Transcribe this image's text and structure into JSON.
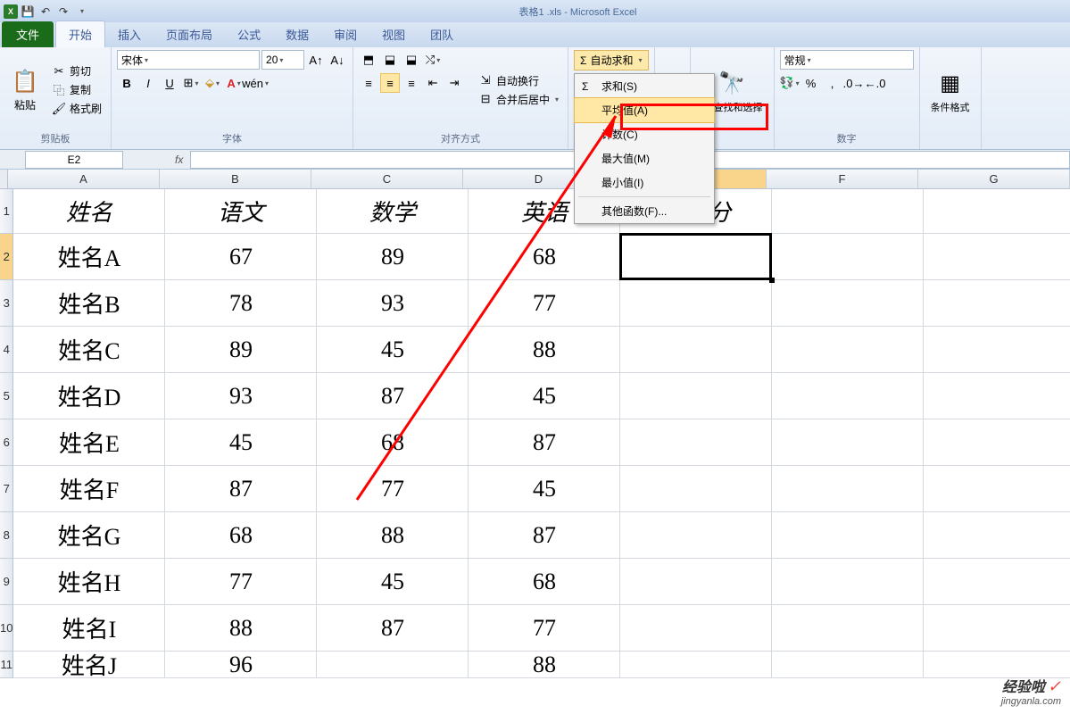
{
  "titlebar": {
    "title": "表格1 .xls - Microsoft Excel"
  },
  "tabs": {
    "file": "文件",
    "items": [
      "开始",
      "插入",
      "页面布局",
      "公式",
      "数据",
      "审阅",
      "视图",
      "团队"
    ]
  },
  "clipboard": {
    "paste": "粘贴",
    "cut": "剪切",
    "copy": "复制",
    "format_painter": "格式刷",
    "label": "剪贴板"
  },
  "font": {
    "name": "宋体",
    "size": "20",
    "label": "字体"
  },
  "align": {
    "wrap": "自动换行",
    "merge": "合并后居中",
    "label": "对齐方式"
  },
  "editing": {
    "autosum": "自动求和",
    "menu": {
      "sum": "求和(S)",
      "avg": "平均值(A)",
      "count": "计数(C)",
      "max": "最大值(M)",
      "min": "最小值(I)",
      "other": "其他函数(F)..."
    },
    "filter_select": "选 查找和选择"
  },
  "number": {
    "format": "常规",
    "label": "数字",
    "cond_format": "条件格式"
  },
  "find_icon": "查找",
  "namebox": "E2",
  "columns": [
    "A",
    "B",
    "C",
    "D",
    "E",
    "F",
    "G"
  ],
  "headers": {
    "A": "姓名",
    "B": "语文",
    "C": "数学",
    "D": "英语",
    "E": "平均分"
  },
  "rows": [
    {
      "n": "1"
    },
    {
      "n": "2",
      "A": "姓名A",
      "B": "67",
      "C": "89",
      "D": "68"
    },
    {
      "n": "3",
      "A": "姓名B",
      "B": "78",
      "C": "93",
      "D": "77"
    },
    {
      "n": "4",
      "A": "姓名C",
      "B": "89",
      "C": "45",
      "D": "88"
    },
    {
      "n": "5",
      "A": "姓名D",
      "B": "93",
      "C": "87",
      "D": "45"
    },
    {
      "n": "6",
      "A": "姓名E",
      "B": "45",
      "C": "68",
      "D": "87"
    },
    {
      "n": "7",
      "A": "姓名F",
      "B": "87",
      "C": "77",
      "D": "45"
    },
    {
      "n": "8",
      "A": "姓名G",
      "B": "68",
      "C": "88",
      "D": "87"
    },
    {
      "n": "9",
      "A": "姓名H",
      "B": "77",
      "C": "45",
      "D": "68"
    },
    {
      "n": "10",
      "A": "姓名I",
      "B": "88",
      "C": "87",
      "D": "77"
    },
    {
      "n": "11",
      "A": "姓名J",
      "B": "96",
      "C": "",
      "D": "88"
    }
  ],
  "watermark": {
    "line1": "经验啦",
    "line2": "jingyanla.com"
  }
}
